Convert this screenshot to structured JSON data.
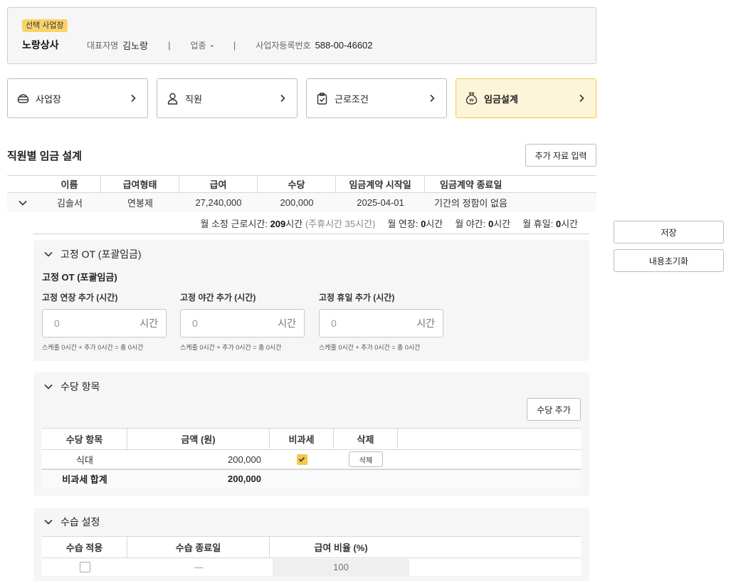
{
  "company": {
    "badge": "선택 사업장",
    "name": "노랑상사",
    "ceo_label": "대표자명",
    "ceo_value": "김노랑",
    "industry_label": "업종",
    "industry_value": "-",
    "separator": "|",
    "bizno_label": "사업자등록번호",
    "bizno_value": "588-00-46602"
  },
  "steps": [
    {
      "label": "사업장",
      "icon": "building-icon"
    },
    {
      "label": "직원",
      "icon": "person-icon"
    },
    {
      "label": "근로조건",
      "icon": "clipboard-check-icon"
    },
    {
      "label": "임금설계",
      "icon": "money-bag-icon",
      "active": true
    }
  ],
  "section": {
    "title": "직원별 임금 설계",
    "add_data_button": "추가 자료 입력"
  },
  "actions": {
    "save": "저장",
    "reset": "내용초기화"
  },
  "wage_table": {
    "columns": [
      "이름",
      "급여형태",
      "급여",
      "수당",
      "임금계약 시작일",
      "임금계약 종료일"
    ],
    "row": {
      "name": "김솔서",
      "pay_type": "연봉제",
      "salary": "27,240,000",
      "allowance": "200,000",
      "start": "2025-04-01",
      "end": "기간의 정함이 없음"
    }
  },
  "hours": {
    "regular_label": "월 소정 근로시간:",
    "regular_value": "209",
    "unit": "시간",
    "weekly_note": "(주휴시간 35시간)",
    "ot_label": "월 연장:",
    "ot_value": "0",
    "night_label": "월 야간:",
    "night_value": "0",
    "holiday_label": "월 휴일:",
    "holiday_value": "0"
  },
  "fixed_ot": {
    "header": "고정 OT (포괄임금)",
    "title": "고정 OT (포괄임금)",
    "fields": [
      {
        "label": "고정 연장 추가 (시간)",
        "placeholder": "0",
        "unit": "시간",
        "hint": "스케줄 0시간 + 추가 0시간 = 총 0시간"
      },
      {
        "label": "고정 야간 추가 (시간)",
        "placeholder": "0",
        "unit": "시간",
        "hint": "스케줄 0시간 + 추가 0시간 = 총 0시간"
      },
      {
        "label": "고정 휴일 추가 (시간)",
        "placeholder": "0",
        "unit": "시간",
        "hint": "스케줄 0시간 + 추가 0시간 = 총 0시간"
      }
    ]
  },
  "allowance": {
    "header": "수당 항목",
    "add_button": "수당 추가",
    "columns": [
      "수당 항목",
      "금액 (원)",
      "비과세",
      "삭제"
    ],
    "rows": [
      {
        "item": "식대",
        "amount": "200,000",
        "tax_free": true,
        "delete_label": "삭제"
      }
    ],
    "footer_label": "비과세 합계",
    "footer_value": "200,000"
  },
  "probation": {
    "header": "수습 설정",
    "columns": [
      "수습 적용",
      "수습 종료일",
      "급여 비율 (%)"
    ],
    "row": {
      "applied": false,
      "end_date": "—",
      "ratio_placeholder": "100"
    }
  }
}
